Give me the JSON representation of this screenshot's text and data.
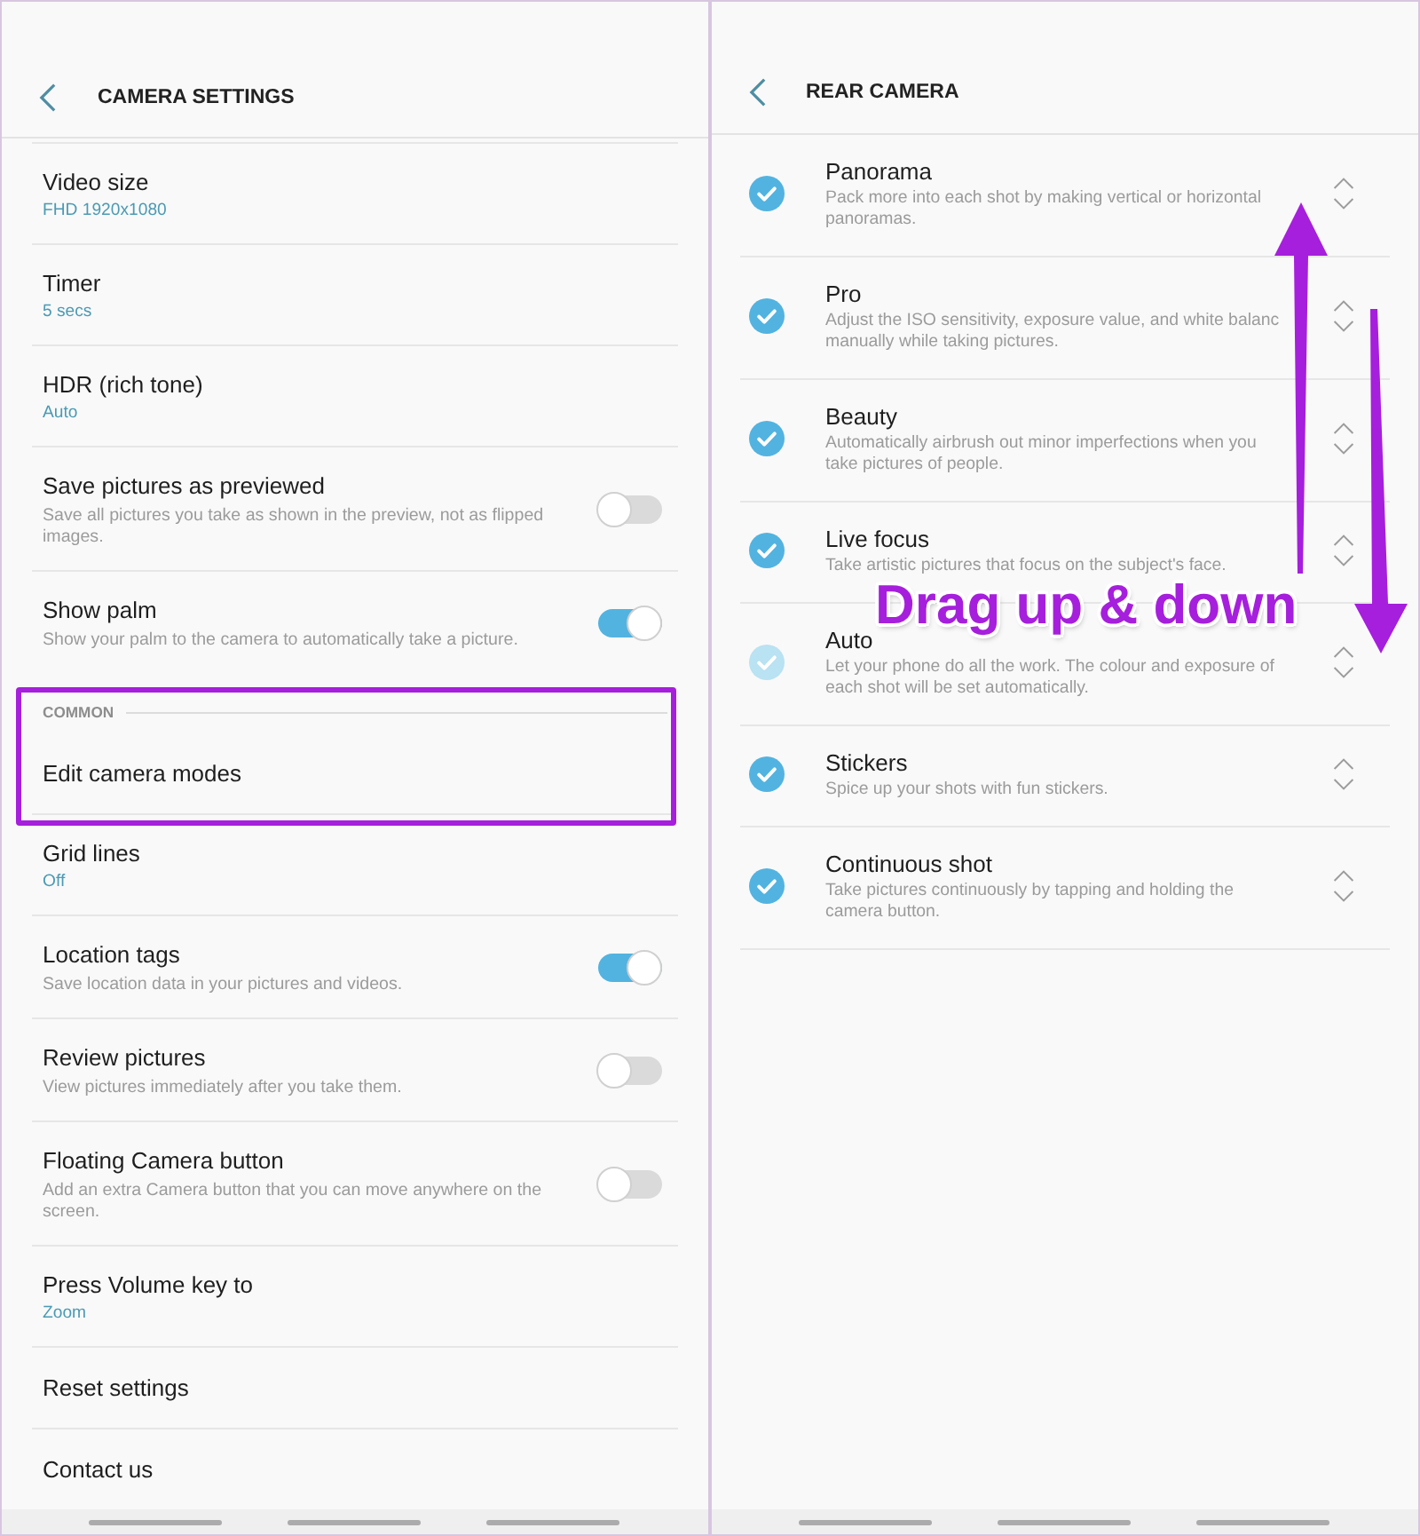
{
  "left_screen": {
    "header": {
      "title": "CAMERA SETTINGS"
    },
    "items": [
      {
        "kind": "value",
        "title": "Video size",
        "value": "FHD 1920x1080"
      },
      {
        "kind": "value",
        "title": "Timer",
        "value": "5 secs"
      },
      {
        "kind": "value",
        "title": "HDR (rich tone)",
        "value": "Auto"
      },
      {
        "kind": "switch",
        "title": "Save pictures as previewed",
        "description": "Save all pictures you take as shown in the preview, not as flipped images.",
        "on": false
      },
      {
        "kind": "switch",
        "title": "Show palm",
        "description": "Show your palm to the camera to automatically take a picture.",
        "on": true
      },
      {
        "kind": "callout",
        "items": [
          {
            "kind": "section",
            "title": "COMMON"
          },
          {
            "kind": "link",
            "title": "Edit camera modes"
          }
        ]
      },
      {
        "kind": "value",
        "title": "Grid lines",
        "value": "Off"
      },
      {
        "kind": "switch",
        "title": "Location tags",
        "description": "Save location data in your pictures and videos.",
        "on": true
      },
      {
        "kind": "switch",
        "title": "Review pictures",
        "description": "View pictures immediately after you take them.",
        "on": false
      },
      {
        "kind": "switch",
        "title": "Floating Camera button",
        "description": "Add an extra Camera button that you can move anywhere on the screen.",
        "on": false
      },
      {
        "kind": "value",
        "title": "Press Volume key to",
        "value": "Zoom"
      },
      {
        "kind": "link",
        "title": "Reset settings"
      },
      {
        "kind": "link",
        "title": "Contact us"
      }
    ]
  },
  "right_screen": {
    "header": {
      "title": "REAR CAMERA"
    },
    "modes": [
      {
        "title": "Panorama",
        "description": "Pack more into each shot by making vertical or horizontal panoramas.",
        "checked": true,
        "disabled": false
      },
      {
        "title": "Pro",
        "description": "Adjust the ISO sensitivity, exposure value, and white balanc manually while taking pictures.",
        "checked": true,
        "disabled": false
      },
      {
        "title": "Beauty",
        "description": "Automatically airbrush out minor imperfections when you take pictures of people.",
        "checked": true,
        "disabled": false
      },
      {
        "title": "Live focus",
        "description": "Take artistic pictures that focus on the subject's face.",
        "checked": true,
        "disabled": false
      },
      {
        "title": "Auto",
        "description": "Let your phone do all the work. The colour and exposure of each shot will be set automatically.",
        "checked": true,
        "disabled": true
      },
      {
        "title": "Stickers",
        "description": "Spice up your shots with fun stickers.",
        "checked": true,
        "disabled": false
      },
      {
        "title": "Continuous shot",
        "description": "Take pictures continuously by tapping and holding the camera button.",
        "checked": true,
        "disabled": false
      }
    ]
  },
  "annotation": {
    "label": "Drag up & down"
  }
}
